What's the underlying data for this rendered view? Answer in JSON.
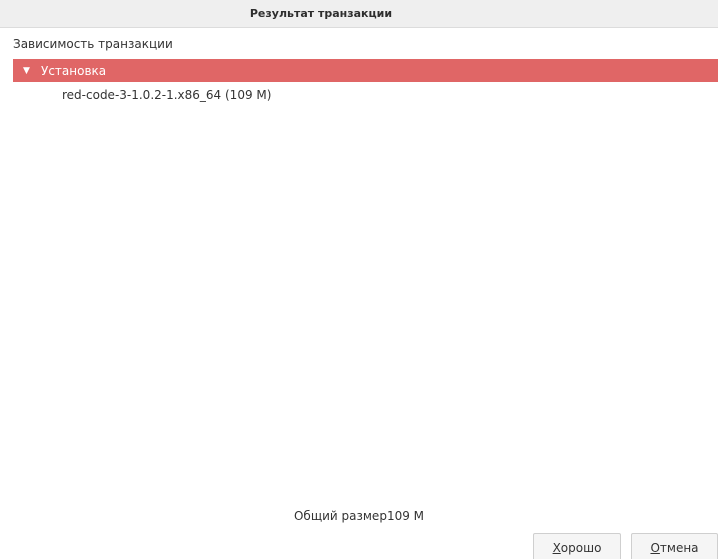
{
  "window": {
    "title": "Результат транзакции"
  },
  "dependencies": {
    "label": "Зависимость транзакции",
    "group": {
      "label": "Установка",
      "expander_icon": "triangle-down-icon",
      "color": "#e06666"
    },
    "packages": [
      "red-code-3-1.0.2-1.x86_64 (109 M)"
    ]
  },
  "total": {
    "label": "Общий размер",
    "value": "109 M"
  },
  "buttons": {
    "ok": {
      "mnemonic": "Х",
      "rest": "орошо"
    },
    "cancel": {
      "mnemonic": "О",
      "rest": "тмена"
    }
  }
}
